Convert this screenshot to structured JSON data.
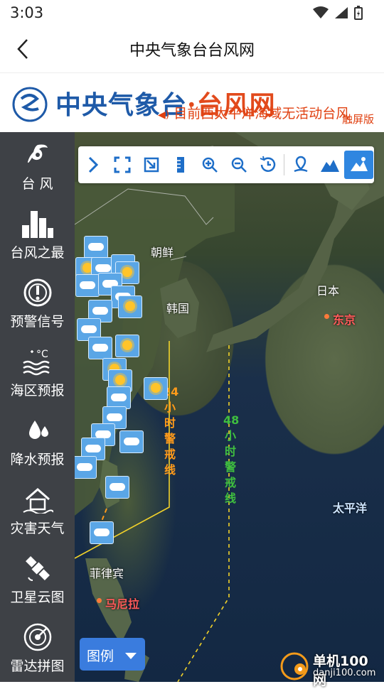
{
  "status": {
    "time": "3:03"
  },
  "appbar": {
    "title": "中央气象台台风网"
  },
  "banner": {
    "logo_main": "中央气象台",
    "logo_dot": "·",
    "logo_sub": "台风网",
    "ticker": "目前西太平洋海域无活动台风",
    "fullscreen_label": "触屏版"
  },
  "toolbar": {
    "tools": [
      "expand-icon",
      "fullscreen-icon",
      "export-icon",
      "ruler-icon",
      "zoom-in-icon",
      "zoom-out-icon",
      "history-icon",
      "location-icon",
      "terrain-icon",
      "satellite-map-icon"
    ]
  },
  "sidebar": {
    "items": [
      {
        "label": "台 风",
        "icon": "typhoon-icon"
      },
      {
        "label": "台风之最",
        "icon": "bar-chart-icon"
      },
      {
        "label": "预警信号",
        "icon": "warning-signal-icon"
      },
      {
        "label": "海区预报",
        "icon": "sea-temperature-icon"
      },
      {
        "label": "降水预报",
        "icon": "raindrop-icon"
      },
      {
        "label": "灾害天气",
        "icon": "disaster-house-icon"
      },
      {
        "label": "卫星云图",
        "icon": "satellite-icon"
      },
      {
        "label": "雷达拼图",
        "icon": "radar-icon"
      }
    ]
  },
  "map": {
    "labels": {
      "north_korea": "朝鲜",
      "korea": "韩国",
      "japan": "日本",
      "tokyo": "东京",
      "pacific": "太平洋",
      "philippines": "菲律宾",
      "manila": "马尼拉"
    },
    "warning_24h": [
      "24",
      "小",
      "时",
      "警",
      "戒",
      "线"
    ],
    "warning_48h": [
      "48",
      "小",
      "时",
      "警",
      "戒",
      "线"
    ],
    "colors": {
      "line24": "#f2d22a",
      "text24": "#ff9a1a",
      "text48": "#3fbf3f"
    }
  },
  "legend_button": {
    "label": "图例"
  },
  "watermark": {
    "line1": "单机100网",
    "line2": "danji100.com"
  }
}
